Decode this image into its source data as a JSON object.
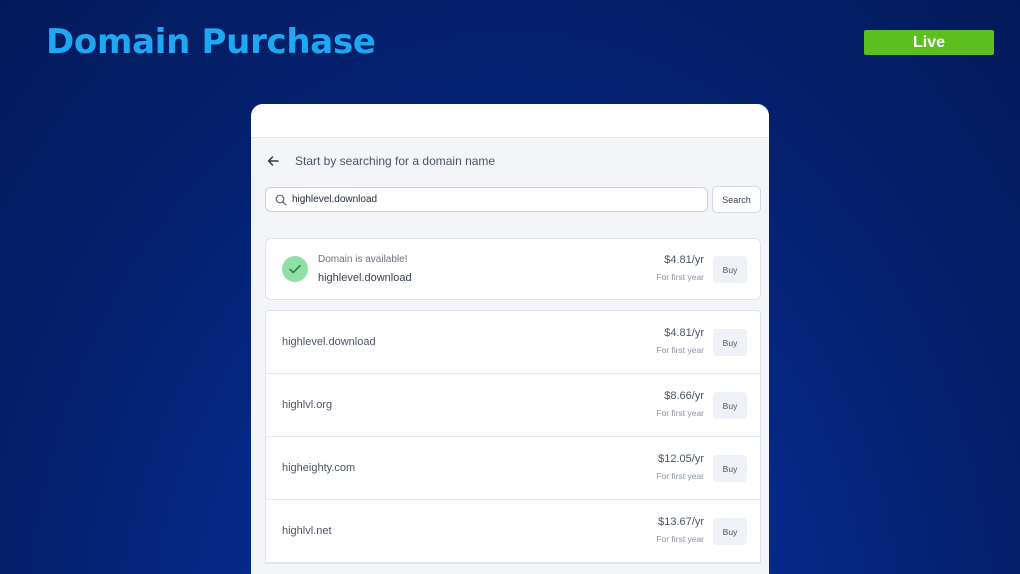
{
  "slide": {
    "title": "Domain Purchase",
    "badge": "Live"
  },
  "colors": {
    "title": "#1fa8f2",
    "badge": "#5cbf1f",
    "available_check": "#8ee0a4"
  },
  "panel": {
    "heading": "Start by searching for a domain name",
    "back_icon": "arrow-left-icon",
    "search": {
      "value": "highlevel.download",
      "icon": "search-icon",
      "button_label": "Search"
    },
    "available": {
      "status": "Domain is available!",
      "domain": "highlevel.download",
      "price": "$4.81/yr",
      "price_note": "For first year",
      "buy_label": "Buy"
    },
    "results": [
      {
        "domain": "highlevel.download",
        "price": "$4.81/yr",
        "price_note": "For first year",
        "buy_label": "Buy"
      },
      {
        "domain": "highlvl.org",
        "price": "$8.66/yr",
        "price_note": "For first year",
        "buy_label": "Buy"
      },
      {
        "domain": "higheighty.com",
        "price": "$12.05/yr",
        "price_note": "For first year",
        "buy_label": "Buy"
      },
      {
        "domain": "highlvl.net",
        "price": "$13.67/yr",
        "price_note": "For first year",
        "buy_label": "Buy"
      }
    ]
  }
}
